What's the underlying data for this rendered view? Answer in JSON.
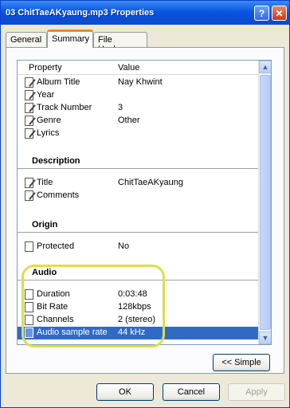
{
  "window": {
    "title": "03 ChitTaeAKyaung.mp3 Properties"
  },
  "title_buttons": {
    "help": "?",
    "close": "✕"
  },
  "tabs": [
    {
      "label": "General"
    },
    {
      "label": "Summary",
      "active": true
    },
    {
      "label": "File Hashes"
    }
  ],
  "list": {
    "header": {
      "property": "Property",
      "value": "Value"
    },
    "rows_top": [
      {
        "name": "Album Title",
        "value": "Nay Khwint",
        "icon": "edit-icon"
      },
      {
        "name": "Year",
        "value": "",
        "icon": "edit-icon"
      },
      {
        "name": "Track Number",
        "value": "3",
        "icon": "edit-icon"
      },
      {
        "name": "Genre",
        "value": "Other",
        "icon": "edit-icon"
      },
      {
        "name": "Lyrics",
        "value": "",
        "icon": "edit-icon"
      }
    ],
    "description": {
      "heading": "Description",
      "rows": [
        {
          "name": "Title",
          "value": "ChitTaeAKyaung",
          "icon": "edit-icon"
        },
        {
          "name": "Comments",
          "value": "",
          "icon": "edit-icon"
        }
      ]
    },
    "origin": {
      "heading": "Origin",
      "rows": [
        {
          "name": "Protected",
          "value": "No",
          "icon": "page-icon"
        }
      ]
    },
    "audio": {
      "heading": "Audio",
      "rows": [
        {
          "name": "Duration",
          "value": "0:03:48",
          "icon": "page-icon"
        },
        {
          "name": "Bit Rate",
          "value": "128kbps",
          "icon": "page-icon"
        },
        {
          "name": "Channels",
          "value": "2 (stereo)",
          "icon": "page-icon"
        },
        {
          "name": "Audio sample rate",
          "value": "44 kHz",
          "icon": "page-icon",
          "selected": true
        }
      ]
    }
  },
  "buttons": {
    "simple": "<< Simple",
    "ok": "OK",
    "cancel": "Cancel",
    "apply": "Apply"
  },
  "colors": {
    "titlebar": "#0857E2",
    "selection": "#316AC5",
    "highlight_ring": "#D9E04A",
    "tab_accent": "#E68B2C"
  }
}
